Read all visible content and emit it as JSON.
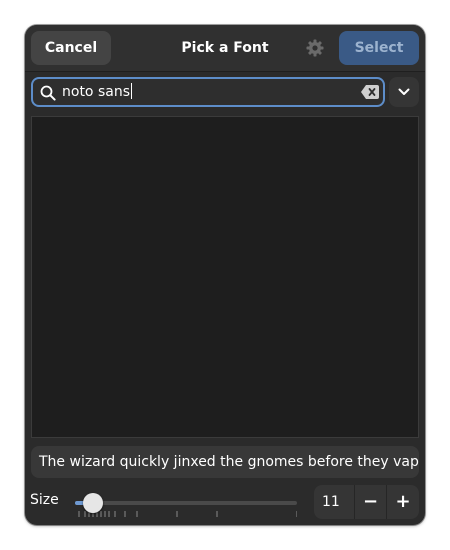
{
  "header": {
    "title": "Pick a Font",
    "cancel_label": "Cancel",
    "select_label": "Select",
    "settings_icon": "gear-icon"
  },
  "search": {
    "value": "noto sans",
    "icon": "search-icon",
    "clear_icon": "clear-text-icon",
    "dropdown_icon": "chevron-down-icon"
  },
  "font_list": {
    "items": []
  },
  "preview": {
    "text": "The wizard quickly jinxed the gnomes before they vaporized."
  },
  "size": {
    "label": "Size",
    "value": "11",
    "slider_fraction": 0.08,
    "minus_label": "−",
    "plus_label": "+"
  },
  "colors": {
    "window_bg": "#2b2b2b",
    "accent": "#5d8dc9",
    "select_button_bg": "#3a5a86",
    "list_bg": "#1e1e1e"
  }
}
